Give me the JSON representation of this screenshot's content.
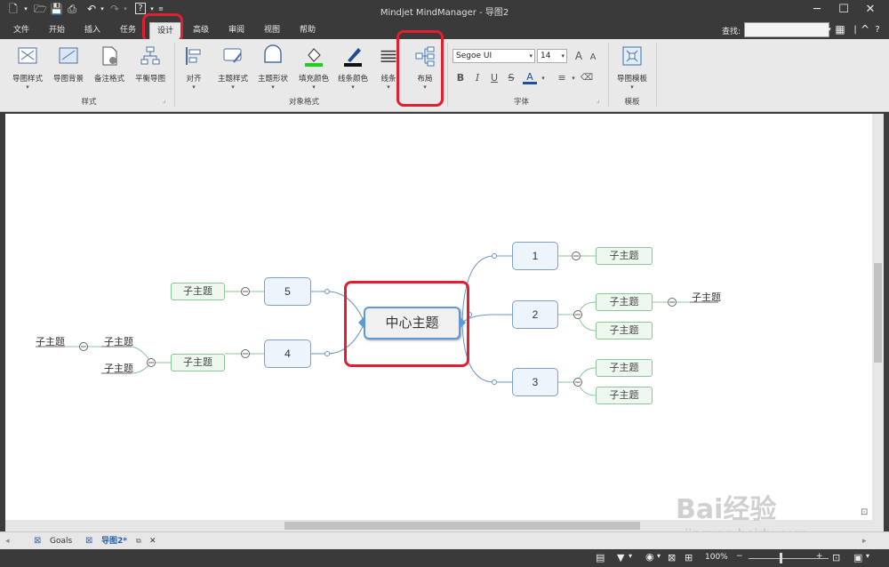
{
  "window": {
    "title": "Mindjet MindManager - 导图2"
  },
  "menu_tabs": [
    "文件",
    "开始",
    "插入",
    "任务",
    "设计",
    "高级",
    "审阅",
    "视图",
    "帮助"
  ],
  "active_tab": "设计",
  "search": {
    "label": "查找:",
    "value": ""
  },
  "ribbon": {
    "style_group": {
      "label": "样式",
      "buttons": [
        "导图样式",
        "导图背景",
        "备注格式",
        "平衡导图"
      ]
    },
    "object_format_group": {
      "label": "对象格式",
      "buttons": [
        "对齐",
        "主题样式",
        "主题形状",
        "填充颜色",
        "线条颜色",
        "线条",
        "布局"
      ]
    },
    "font_group": {
      "label": "字体",
      "font_name": "Segoe UI",
      "font_size": "14",
      "buttons": [
        "B",
        "I",
        "U",
        "S",
        "A"
      ]
    },
    "template_group": {
      "label": "模板",
      "buttons": [
        "导图模板"
      ]
    }
  },
  "mindmap": {
    "central": "中心主题",
    "topics": {
      "t1": "1",
      "t2": "2",
      "t3": "3",
      "t4": "4",
      "t5": "5"
    },
    "subtopic_label": "子主题"
  },
  "doc_tabs": {
    "goals": "Goals",
    "map2": "导图2*"
  },
  "status": {
    "zoom": "100%"
  },
  "watermark": {
    "line1": "Bai经验",
    "line2": "jingyan.baidu.com"
  },
  "colors": {
    "highlight": "#e02030",
    "topic_border": "#7c9fcb",
    "leaf_border": "#8cc49a",
    "connector": "#6a93c4"
  }
}
